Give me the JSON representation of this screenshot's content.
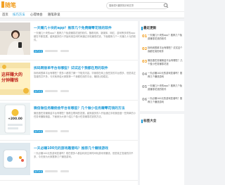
{
  "header": {
    "logo": "随笔",
    "search_placeholder": "搜索感兴趣的知识和文章"
  },
  "nav": [
    {
      "label": "首页",
      "active": false
    },
    {
      "label": "技巧方法",
      "active": true
    },
    {
      "label": "心得体会",
      "active": false
    },
    {
      "label": "随笔杂谈",
      "active": false
    }
  ],
  "articles": [
    {
      "title": "一天赚几十块的app？推荐几个免费赚零花钱的软件",
      "summary": "一天赚几十块的app？推荐几个免费赚零花钱的软件。随着电商、新媒体、网红、游戏等多样的app都在不断发展，越来越多的人开始利用空闲时间通过手机赚零花钱，下面推荐几个一天赚几十元的软件。",
      "category": "技巧方法"
    },
    {
      "title": "拆码网很单平台有哪些？试试这个我都在用的软件",
      "summary": "拆码网很单平台有哪些？很多人都想了解一下相关内容，毕竟现在网上做任务的平台很多，但是真正靠谱的并不多，今天就来给大家推荐一个我都在用的平台，赚钱比较稳定。",
      "category": "技巧方法",
      "thumb_text": "这样赚大的\n分钟赚钱"
    },
    {
      "title": "微信做任务赚佣金平台有哪些？几个做小任务赚零花钱的方法",
      "summary": "微信做任务赚佣金平台有哪些？随着互联网的发展，越来越多的人开始通过手机微信做一些简单的小任务来赚取佣金，下面就为大家介绍几个做小任务赚零花钱的方法。",
      "category": "技巧方法",
      "thumb_text": "+200.00"
    },
    {
      "title": "一天必赚100元的游戏靠谱吗？推荐几个赚钱游戏",
      "summary": "一天必赚100元的游戏靠谱吗？现在很多人都会利用空闲时间玩游戏来赚钱，但是真正靠谱的并不多，今天就为大家推荐几个赚钱游戏。",
      "category": "技巧方法"
    }
  ],
  "sidebar": {
    "hot_title": "最近更新",
    "hot": [
      {
        "num": "01",
        "text": "一天赚几十块的app？推荐几个免费赚零花钱的软件"
      },
      {
        "num": "02",
        "text": "拆码网很单平台有哪些？试试这个我都在用的软件"
      },
      {
        "num": "03",
        "text": "微信做任务赚佣金平台有哪些？几个做小任务赚零花钱"
      },
      {
        "num": "04",
        "text": "一天必赚100元的游戏靠谱吗？推荐几个赚钱游戏"
      },
      {
        "num": "05",
        "text": "一天赚几十块的app？推荐几个免费赚零花钱的软件"
      },
      {
        "num": "06",
        "text": "一天必赚100元的游戏靠谱吗？推荐几个赚钱游戏"
      }
    ],
    "tags_title": "标签大全"
  },
  "colors": {
    "accent": "#1d9bd8",
    "number": "#f2a024",
    "background": "#f2f3f5"
  }
}
